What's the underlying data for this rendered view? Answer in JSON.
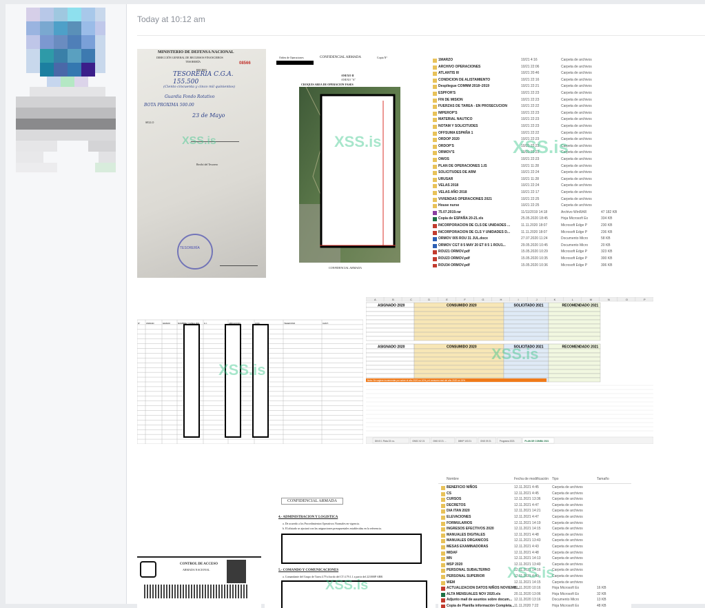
{
  "message": {
    "timestamp": "Today at 10:12 am"
  },
  "colors": {
    "watermark": "#3cc88c",
    "accent_orange": "#f07a1a",
    "excel_green": "#1e7145"
  },
  "watermark_text": "XSS.is",
  "attachments": {
    "receipt": {
      "heading": "MINISTERIO DE DEFENSA NACIONAL",
      "subheading": "DIRECCIÓN GENERAL DE RECURSOS FINANCIEROS",
      "dept": "TESORERÍA",
      "number": "08566",
      "recibo": "RECIBO",
      "handwriting_1": "TESORERIA C.G.A.",
      "handwriting_2": "155.500",
      "handwriting_3": "(Ciento cincuenta y cinco mil quinientos)",
      "handwriting_4": "Guardia Fondo Rotativo",
      "handwriting_5": "BOTA PROXIMA 500.00",
      "handwriting_6": "23 de Mayo",
      "sello": "SELLO",
      "firma": "Recibí del Tesorero",
      "stamp": "TESORERÍA"
    },
    "map_doc": {
      "orden": "Orden de Operaciones",
      "conf": "CONFIDENCIAL ARMADA",
      "copia": "Copia N°",
      "anexo": "ANEXO II",
      "anexo_sub": "ANEXO \"A\"",
      "croquis": "CROQUIS AREA DE OPERACION FASES",
      "footer": "CONFIDENCIAL ARMADA"
    },
    "explorer1": {
      "rows": [
        [
          "1MARZO",
          "10/21 4:16",
          "Carpeta de archivos",
          ""
        ],
        [
          "ARCHIVO OPERACIONES",
          "10/21 22:06",
          "Carpeta de archivos",
          ""
        ],
        [
          "ATLANTIS III",
          "10/21 20:46",
          "Carpeta de archivos",
          ""
        ],
        [
          "CONDICION DE ALISTAMIENTO",
          "10/21 22:16",
          "Carpeta de archivos",
          ""
        ],
        [
          "Despliegue COMNM 2018~2019",
          "10/21 22:21",
          "Carpeta de archivos",
          ""
        ],
        [
          "ESPFOR'S",
          "10/21 22:23",
          "Carpeta de archivos",
          ""
        ],
        [
          "FIN DE MISION",
          "10/21 22:23",
          "Carpeta de archivos",
          ""
        ],
        [
          "FUERZAS DE TAREA - EN PROSECUCION",
          "10/21 22:22",
          "Carpeta de archivos",
          ""
        ],
        [
          "IMPEROP'S",
          "10/21 22:23",
          "Carpeta de archivos",
          ""
        ],
        [
          "MATERIAL NAUTICO",
          "10/21 22:23",
          "Carpeta de archivos",
          ""
        ],
        [
          "NOTAM Y SOLICITUDES",
          "10/21 22:23",
          "Carpeta de archivos",
          ""
        ],
        [
          "OFFSUMA ESPAÑA 1",
          "10/21 22:22",
          "Carpeta de archivos",
          ""
        ],
        [
          "ORDOP 2020",
          "10/21 22:23",
          "Carpeta de archivos",
          ""
        ],
        [
          "ORDOP'S",
          "10/21 22:23",
          "Carpeta de archivos",
          ""
        ],
        [
          "ORMOV'S",
          "10/21 22:23",
          "Carpeta de archivos",
          ""
        ],
        [
          "OWOS",
          "10/21 22:23",
          "Carpeta de archivos",
          ""
        ],
        [
          "PLAN DE OPERACIONES 1.IS",
          "10/21 11:28",
          "Carpeta de archivos",
          ""
        ],
        [
          "SOLICITUDES DE ARM",
          "10/21 22:24",
          "Carpeta de archivos",
          ""
        ],
        [
          "URUSAR",
          "10/21 11:28",
          "Carpeta de archivos",
          ""
        ],
        [
          "VELAS 2018",
          "10/21 22:24",
          "Carpeta de archivos",
          ""
        ],
        [
          "VELAS AÑO 2018",
          "10/21 22:17",
          "Carpeta de archivos",
          ""
        ],
        [
          "VIVIENDAS OPERACIONES 2021",
          "10/21 22:25",
          "Carpeta de archivos",
          ""
        ],
        [
          "House nurse",
          "10/21 22:25",
          "Carpeta de archivos",
          ""
        ],
        [
          "75.07.2019.rar",
          "11/11/2019 14:18",
          "Archivo WinRAR",
          "47 182 KB"
        ],
        [
          "Copia de ESPAÑA 20-21.xls",
          "25.05.2020 18:45",
          "Hoja Microsoft Ex",
          "334 KB"
        ],
        [
          "INCORPORACION DE CLS DE UNIDADES ...",
          "11.11.2020 18:07",
          "Microsoft Edge P",
          "230 KB"
        ],
        [
          "INCORPORACION DE CLS Y UNIDADES D...",
          "11.11.2020 18:07",
          "Microsoft Edge P",
          "236 KB"
        ],
        [
          "ORMOV 005 ROU 31 JUL.docx",
          "27.07.2020 11:24",
          "Documento Micro",
          "58 KB"
        ],
        [
          "ORMOV CGT 8 5 MAY 20 ET 8 5 1 ROU1...",
          "29.05.2020 10:45",
          "Documento Micro",
          "20 KB"
        ],
        [
          "ROU21 ORMOV.pdf",
          "15.05.2020 10:29",
          "Microsoft Edge P",
          "323 KB"
        ],
        [
          "ROU23 ORMOV.pdf",
          "15.05.2020 10:35",
          "Microsoft Edge P",
          "300 KB"
        ],
        [
          "ROU34 ORMOV.pdf",
          "15.05.2020 10:36",
          "Microsoft Edge P",
          "306 KB"
        ]
      ]
    },
    "sheet_table": {
      "headers": [
        "N°",
        "UNIDAD",
        "GRADO",
        "NOMBRE Y APELLIDO",
        "C.I.",
        "UBICACION",
        "COD.",
        "TELEFONO",
        "CANT."
      ]
    },
    "excel": {
      "title1": "ASIGNADO 2020",
      "title2": "CONSUMIDO 2020",
      "title3": "SOLICITADO 2021",
      "title4": "RECOMENDADO 2021",
      "note": "Nota: Se sugiere incrementar por sobre el año 2020 un 10% y el consumo real del año 2020 un 15%",
      "tabs": [
        "DIN 5 1 Flota 23 v.s.",
        "GNSC 02 21",
        "GNS 02 21 ...",
        "DBKP 103 21",
        "GNS 09 21",
        "Programa 2021",
        "PLAN DE COMBU 2021"
      ],
      "active_tab": "PLAN DE COMBU 2021",
      "cols": [
        "A",
        "B",
        "C",
        "D",
        "E",
        "F",
        "G",
        "H",
        "I",
        "J",
        "K",
        "L",
        "M",
        "N",
        "O",
        "P"
      ]
    },
    "doc_conf": {
      "header": "CONFIDENCIAL ARMADA",
      "sec4": "4.- ADMINISTRACION Y LOGISTICA",
      "sec4a": "a. De acuerdo a los Procedimientos Operativos Normales en vigencia.",
      "sec4b": "b. El alistado se ajustará con las asignaciones presupuestales establecidas en la referencia.",
      "sec5": "5.- COMANDO Y COMUNICACIONES",
      "sec5a": "a. Comandante del Grupo de Tarea 4.79 a bordo del CT 4.79.1.1 a partir del 221000P ABR"
    },
    "id_card": {
      "title": "CONTROL DE ACCESO",
      "subtitle": "ARMADA NACIONAL"
    },
    "explorer2": {
      "headers": [
        "Nombre",
        "Fecha de modificación",
        "Tipo",
        "Tamaño"
      ],
      "rows": [
        [
          "BENEFICIO NIÑOS",
          "12.11.2021 4:45",
          "Carpeta de archivos",
          ""
        ],
        [
          "CS",
          "12.11.2021 4:45",
          "Carpeta de archivos",
          ""
        ],
        [
          "CURSOS",
          "12.11.2021 13:36",
          "Carpeta de archivos",
          ""
        ],
        [
          "DECRETOS",
          "12.11.2021 4:47",
          "Carpeta de archivos",
          ""
        ],
        [
          "DIA ITAN 2020",
          "12.11.2021 14:21",
          "Carpeta de archivos",
          ""
        ],
        [
          "ELEVACIONES",
          "12.11.2021 4:47",
          "Carpeta de archivos",
          ""
        ],
        [
          "FORMULARIOS",
          "12.11.2021 14:19",
          "Carpeta de archivos",
          ""
        ],
        [
          "INGRESOS EFECTIVOS 2020",
          "12.11.2021 14:15",
          "Carpeta de archivos",
          ""
        ],
        [
          "MANUALES DIGITALES",
          "12.11.2021 4:48",
          "Carpeta de archivos",
          ""
        ],
        [
          "MANUALES ORGANICOS",
          "12.11.2021 13:43",
          "Carpeta de archivos",
          ""
        ],
        [
          "MESAS EXAMINADORAS",
          "12.11.2021 4:43",
          "Carpeta de archivos",
          ""
        ],
        [
          "MIDAF",
          "12.11.2021 4:48",
          "Carpeta de archivos",
          ""
        ],
        [
          "MN",
          "12.11.2021 14:13",
          "Carpeta de archivos",
          ""
        ],
        [
          "MSP 2020",
          "12.11.2021 13:40",
          "Carpeta de archivos",
          ""
        ],
        [
          "PERSONAL SUBALTERNO",
          "12.11.2021 14:16",
          "Carpeta de archivos",
          ""
        ],
        [
          "PERSONAL SUPERIOR",
          "12.11.2021 4:49",
          "Carpeta de archivos",
          ""
        ],
        [
          "WEM",
          "12.11.2021 14:15",
          "Carpeta de archivos",
          ""
        ],
        [
          "ACTUALIZACION DATOS NIÑOS NOVIEMB...",
          "12.11.2020 10:16",
          "Hoja Microsoft Ex",
          "16 KB"
        ],
        [
          "ALTA MENSUALES NOV 2020.xls",
          "20.11.2020 13:06",
          "Hoja Microsoft Ex",
          "32 KB"
        ],
        [
          "Adjunto mail de asuntos sobre docum...",
          "12.11.2020 13:16",
          "Documento Micro",
          "13 KB"
        ],
        [
          "Copia de Planilla información Completa...",
          "11.11.2020 7:22",
          "Hoja Microsoft Ex",
          "48 KB"
        ]
      ]
    }
  }
}
